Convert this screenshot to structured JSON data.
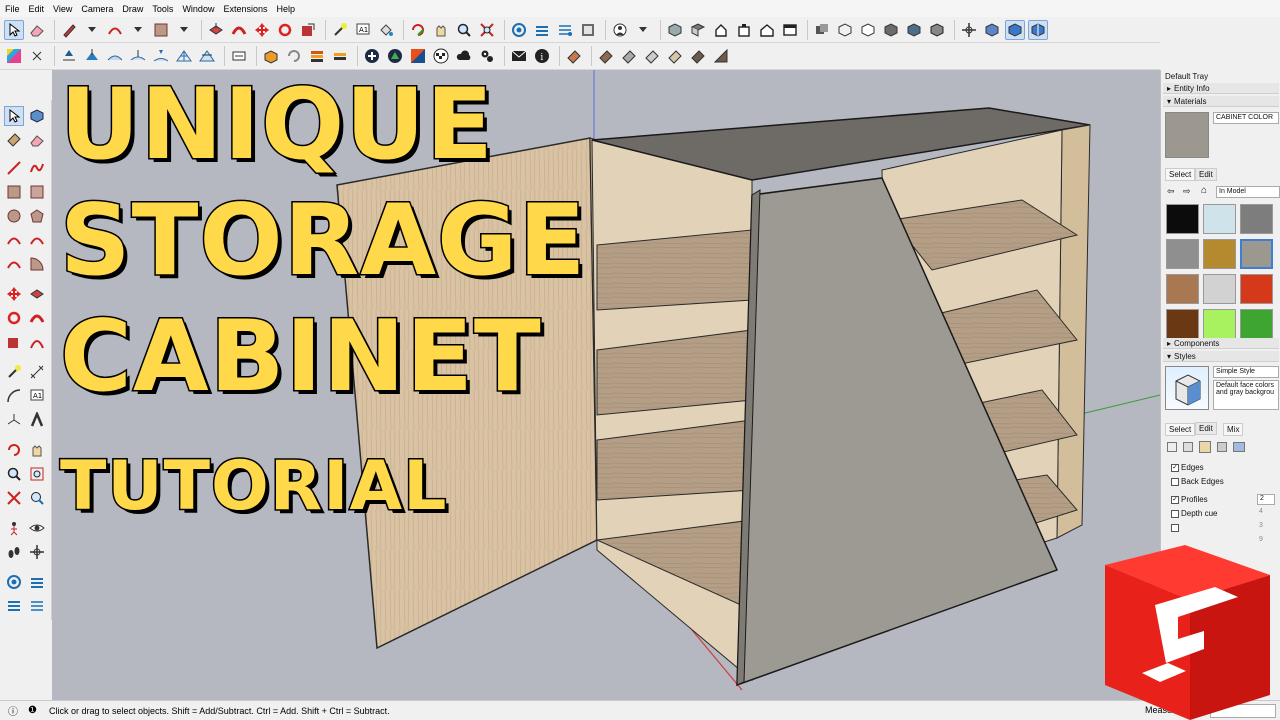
{
  "menu": [
    "File",
    "Edit",
    "View",
    "Camera",
    "Draw",
    "Tools",
    "Window",
    "Extensions",
    "Help"
  ],
  "title": {
    "line1": "UNIQUE",
    "line2": "STORAGE",
    "line3": "CABINET",
    "line4": "TUTORIAL"
  },
  "tray": {
    "title": "Default Tray",
    "entity_info": "Entity Info",
    "materials": "Materials",
    "material_name": "CABINET COLOR",
    "select_tab": "Select",
    "edit_tab": "Edit",
    "collection": "In Model",
    "components": "Components",
    "styles": "Styles",
    "style_name": "Simple Style",
    "style_desc": "Default face colors and gray backgrou",
    "styles_tabs": [
      "Select",
      "Edit",
      "Mix"
    ],
    "edges_label": "Edges",
    "back_edges_label": "Back Edges",
    "profiles_label": "Profiles",
    "profiles_value": "2",
    "depth_cue_label": "Depth cue",
    "depth_cue_value": "4",
    "extension_value": "3",
    "extra_value": "9",
    "edges_checked": true,
    "back_edges_checked": false,
    "profiles_checked": true,
    "depth_cue_checked": false
  },
  "swatches": [
    "#0c0c0c",
    "#cfe3ea",
    "#7d7d7d",
    "#8f8f8f",
    "#b58a2e",
    "#9c978f",
    "#a87852",
    "#d2d2d2",
    "#d6391a",
    "#6a3812",
    "#a7f25e",
    "#3ea531"
  ],
  "status": {
    "hint": "Click or drag to select objects. Shift = Add/Subtract. Ctrl = Add. Shift + Ctrl = Subtract.",
    "measurements_label": "Measurements"
  },
  "colors": {
    "title_fill": "#ffd94a",
    "logo_red": "#e8211a",
    "viewport_bg": "#b5b8c0"
  }
}
